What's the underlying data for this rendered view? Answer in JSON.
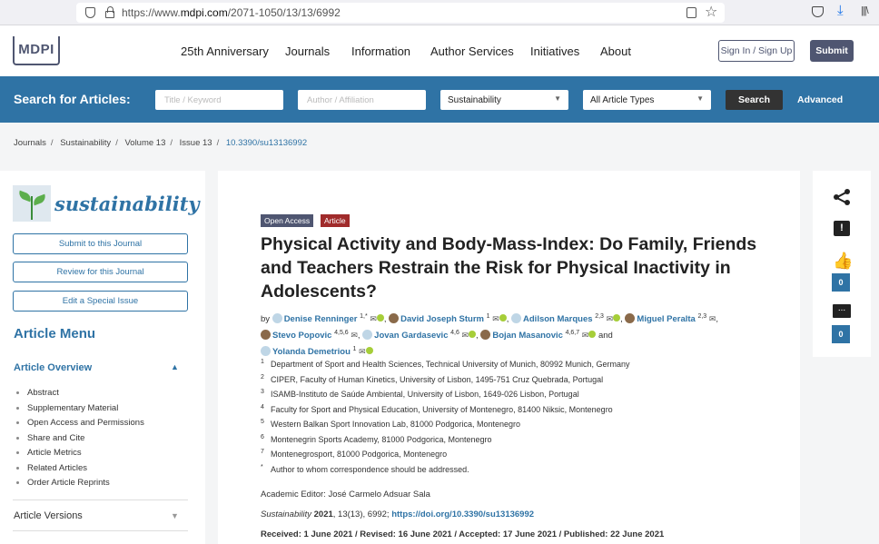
{
  "browser": {
    "url_prefix": "https://www.",
    "url_domain": "mdpi.com",
    "url_path": "/2071-1050/13/13/6992"
  },
  "header": {
    "logo": "MDPI",
    "nav": [
      "25th Anniversary",
      "Journals",
      "Information",
      "Author Services",
      "Initiatives",
      "About"
    ],
    "signin_label": "Sign In / Sign Up",
    "submit_label": "Submit"
  },
  "search": {
    "label": "Search for Articles:",
    "keyword_placeholder": "Title / Keyword",
    "author_placeholder": "Author / Affiliation",
    "journal_value": "Sustainability",
    "type_value": "All Article Types",
    "button_label": "Search",
    "advanced_label": "Advanced"
  },
  "breadcrumb": [
    "Journals",
    "Sustainability",
    "Volume 13",
    "Issue 13",
    "10.3390/su13136992"
  ],
  "sidebar": {
    "journal_name": "sustainability",
    "buttons": [
      "Submit to this Journal",
      "Review for this Journal",
      "Edit a Special Issue"
    ],
    "menu_title": "Article Menu",
    "overview_title": "Article Overview",
    "overview_items": [
      "Abstract",
      "Supplementary Material",
      "Open Access and Permissions",
      "Share and Cite",
      "Article Metrics",
      "Related Articles",
      "Order Article Reprints"
    ],
    "versions_title": "Article Versions"
  },
  "article": {
    "badge_access": "Open Access",
    "badge_type": "Article",
    "title": "Physical Activity and Body-Mass-Index: Do Family, Friends and Teachers Restrain the Risk for Physical Inactivity in Adolescents?",
    "by": "by",
    "and": "and",
    "authors": [
      {
        "name": "Denise Renninger",
        "sup": "1,*"
      },
      {
        "name": "David Joseph Sturm",
        "sup": "1"
      },
      {
        "name": "Adilson Marques",
        "sup": "2,3"
      },
      {
        "name": "Miguel Peralta",
        "sup": "2,3"
      },
      {
        "name": "Stevo Popovic",
        "sup": "4,5,6"
      },
      {
        "name": "Jovan Gardasevic",
        "sup": "4,6"
      },
      {
        "name": "Bojan Masanovic",
        "sup": "4,6,7"
      },
      {
        "name": "Yolanda Demetriou",
        "sup": "1"
      }
    ],
    "affiliations": [
      {
        "num": "1",
        "text": "Department of Sport and Health Sciences, Technical University of Munich, 80992 Munich, Germany"
      },
      {
        "num": "2",
        "text": "CIPER, Faculty of Human Kinetics, University of Lisbon, 1495-751 Cruz Quebrada, Portugal"
      },
      {
        "num": "3",
        "text": "ISAMB-Instituto de Saúde Ambiental, University of Lisbon, 1649-026 Lisbon, Portugal"
      },
      {
        "num": "4",
        "text": "Faculty for Sport and Physical Education, University of Montenegro, 81400 Niksic, Montenegro"
      },
      {
        "num": "5",
        "text": "Western Balkan Sport Innovation Lab, 81000 Podgorica, Montenegro"
      },
      {
        "num": "6",
        "text": "Montenegrin Sports Academy, 81000 Podgorica, Montenegro"
      },
      {
        "num": "7",
        "text": "Montenegrosport, 81000 Podgorica, Montenegro"
      },
      {
        "num": "*",
        "text": "Author to whom correspondence should be addressed."
      }
    ],
    "editor": "Academic Editor: José Carmelo Adsuar Sala",
    "cite_journal": "Sustainability",
    "cite_year": "2021",
    "cite_rest": ", 13(13), 6992;",
    "cite_doi": "https://doi.org/10.3390/su13136992",
    "dates": "Received: 1 June 2021 / Revised: 16 June 2021 / Accepted: 17 June 2021 / Published: 22 June 2021"
  },
  "tools": {
    "like_count": "0",
    "comment_count": "0"
  }
}
